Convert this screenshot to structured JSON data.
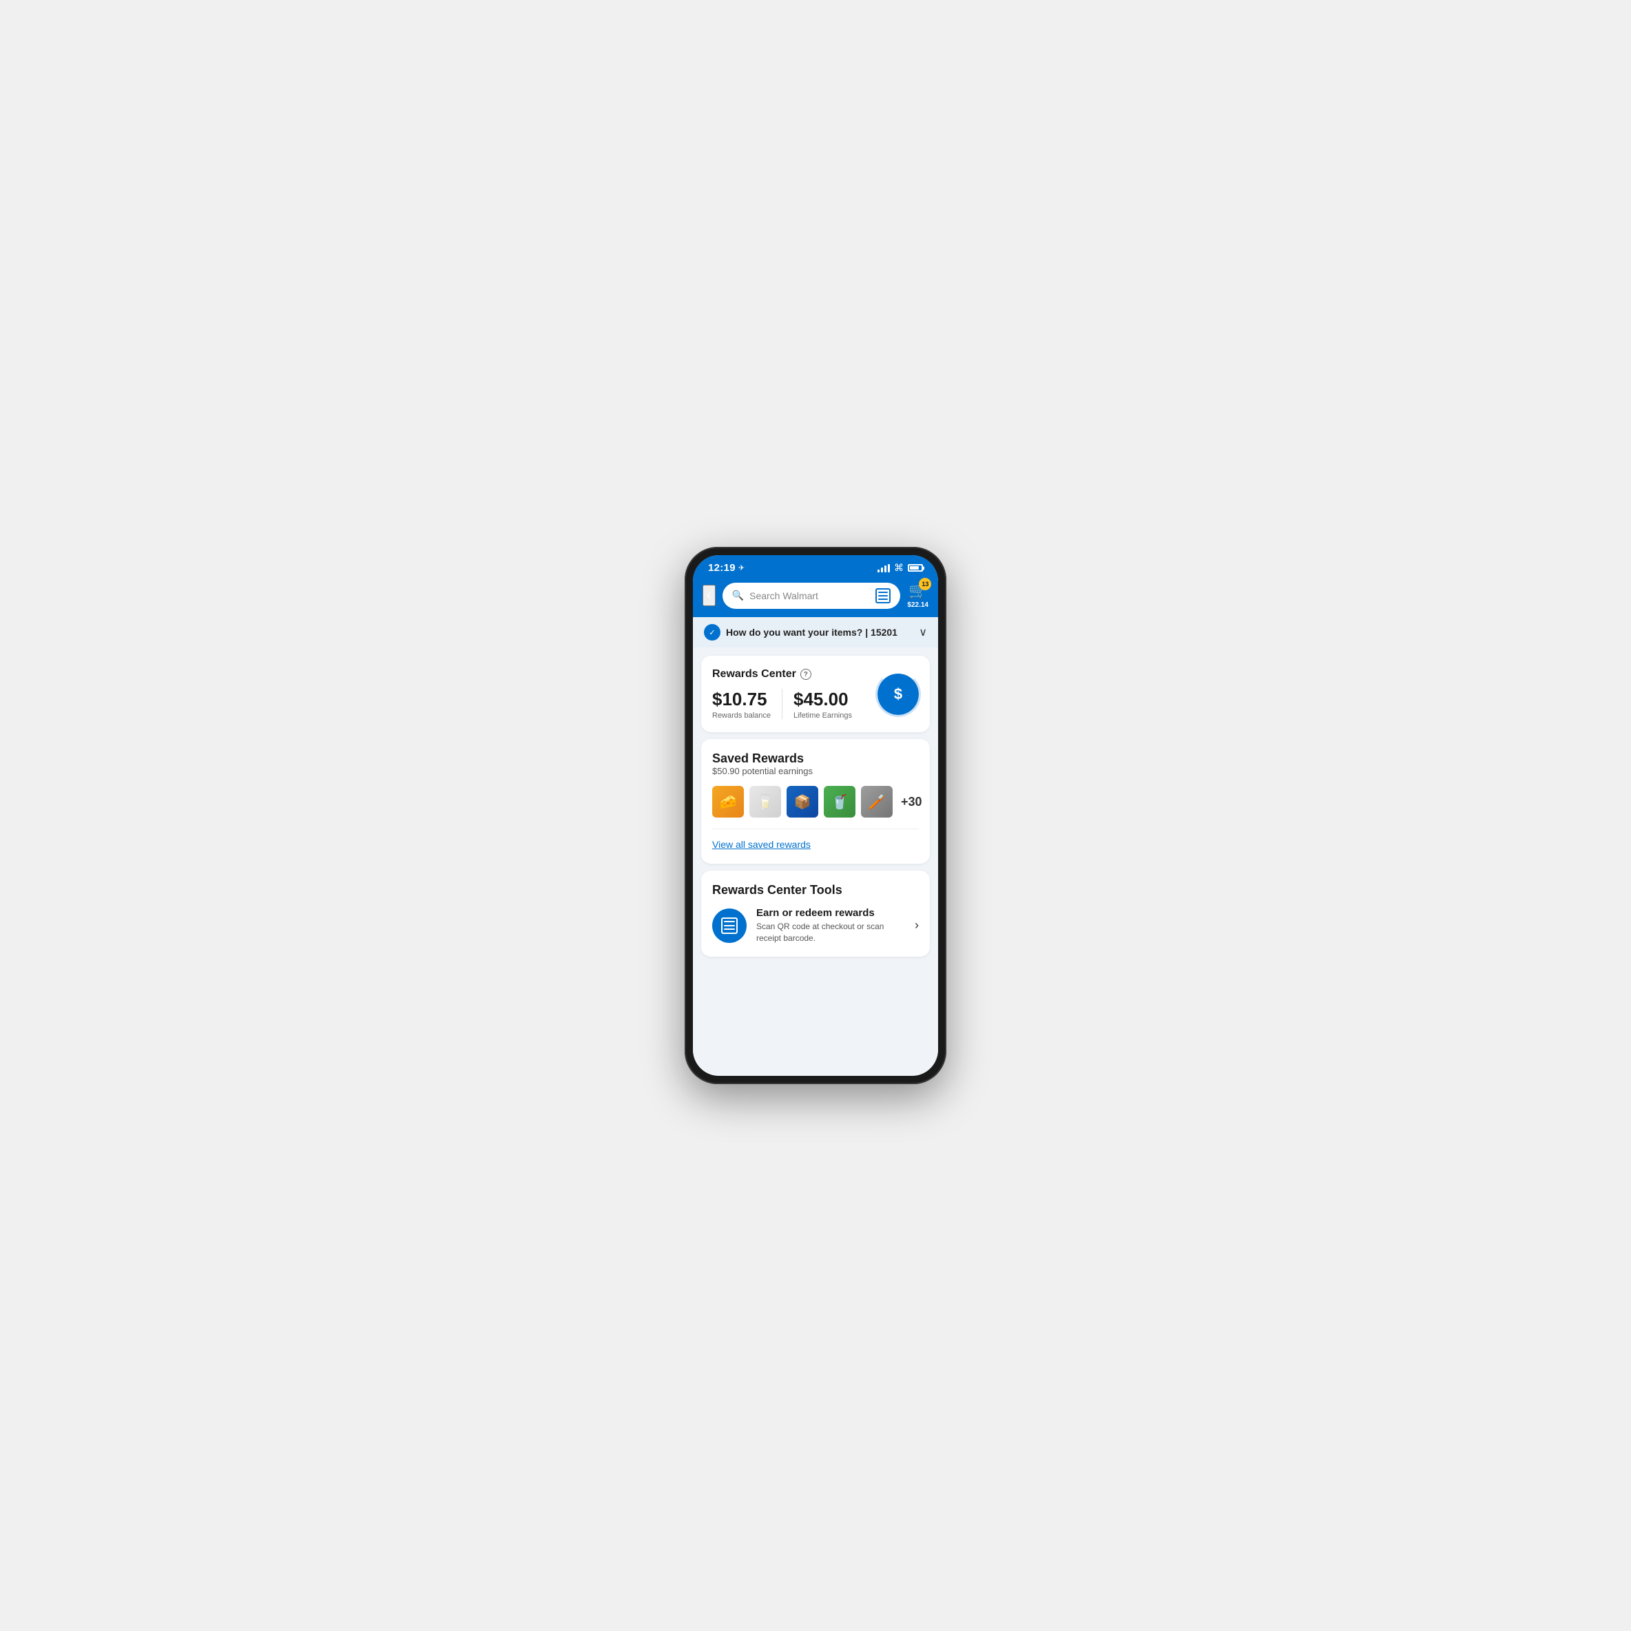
{
  "phone": {
    "status_bar": {
      "time": "12:19",
      "location_icon": "▶",
      "battery_level": 80
    },
    "header": {
      "back_label": "‹",
      "search_placeholder": "Search Walmart",
      "barcode_label": "barcode",
      "cart_badge": "13",
      "cart_price": "$22.14"
    },
    "delivery_bar": {
      "text": "How do you want your items? | 15201",
      "chevron": "∨"
    },
    "rewards_center": {
      "title": "Rewards Center",
      "help": "?",
      "balance_value": "$10.75",
      "balance_label": "Rewards balance",
      "lifetime_value": "$45.00",
      "lifetime_label": "Lifetime Earnings",
      "dollar_symbol": "$"
    },
    "saved_rewards": {
      "title": "Saved Rewards",
      "potential_earnings": "$50.90 potential earnings",
      "more_count": "+30",
      "view_all_label": "View all saved rewards",
      "products": [
        {
          "emoji": "🧀",
          "color_class": "product-velveeta"
        },
        {
          "emoji": "🥛",
          "color_class": "product-white"
        },
        {
          "emoji": "📦",
          "color_class": "product-blue"
        },
        {
          "emoji": "🥤",
          "color_class": "product-green"
        },
        {
          "emoji": "🪥",
          "color_class": "product-silver"
        }
      ]
    },
    "rewards_tools": {
      "title": "Rewards Center Tools",
      "item": {
        "title": "Earn or redeem rewards",
        "description": "Scan QR code at checkout or scan receipt barcode.",
        "arrow": "›"
      }
    }
  }
}
